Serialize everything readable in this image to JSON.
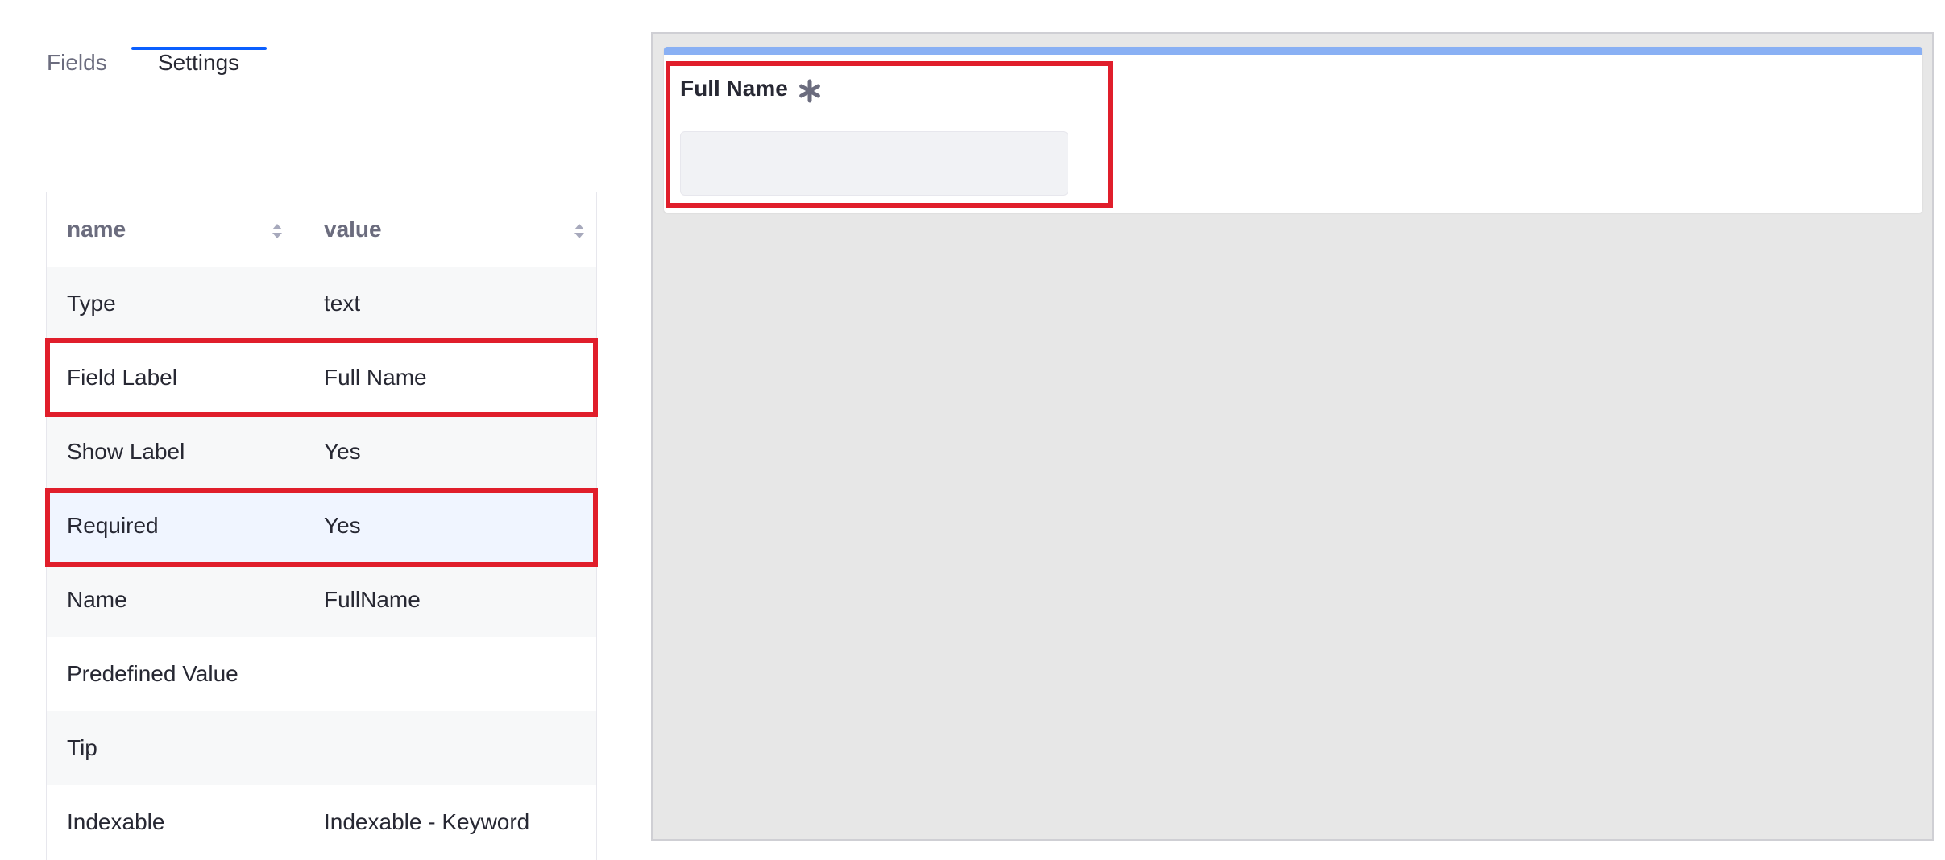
{
  "tabs": [
    {
      "label": "Fields",
      "active": false
    },
    {
      "label": "Settings",
      "active": true
    }
  ],
  "table": {
    "headers": [
      "name",
      "value"
    ],
    "rows": [
      {
        "name": "Type",
        "value": "text"
      },
      {
        "name": "Field Label",
        "value": "Full Name",
        "highlighted": true
      },
      {
        "name": "Show Label",
        "value": "Yes"
      },
      {
        "name": "Required",
        "value": "Yes",
        "highlighted": true,
        "selected": true
      },
      {
        "name": "Name",
        "value": "FullName"
      },
      {
        "name": "Predefined Value",
        "value": ""
      },
      {
        "name": "Tip",
        "value": ""
      },
      {
        "name": "Indexable",
        "value": "Indexable - Keyword"
      }
    ]
  },
  "preview": {
    "field_label": "Full Name",
    "required_icon": "asterisk-icon",
    "input_value": ""
  },
  "colors": {
    "accent": "#0b5fff",
    "highlight": "#e01e2b",
    "card_top_bar": "#89b0f4",
    "canvas_bg": "#e7e7e7"
  }
}
